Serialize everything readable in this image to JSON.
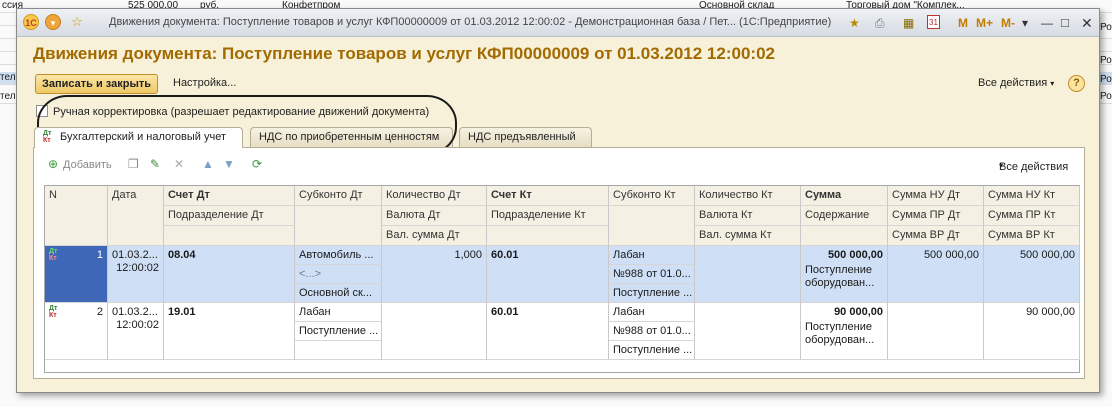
{
  "background": {
    "rows": [
      {
        "c1": "ссия",
        "c2": "525 000,00",
        "c3": "руб.",
        "c4": "Конфетпром",
        "c5": "Основной склад",
        "c6": "Торговый дом \"Комплек..."
      },
      {
        "c1": "",
        "c2": "",
        "c3": "",
        "c4": "",
        "c5": "",
        "c6": ""
      },
      {
        "c1": "",
        "c2": "",
        "c3": "",
        "c4": "",
        "c5": "",
        "c6": ""
      },
      {
        "c1": "",
        "c2": "",
        "c3": "",
        "c4": "",
        "c5": "",
        "c6": ""
      },
      {
        "c1": "",
        "c2": "",
        "c3": "",
        "c4": "",
        "c5": "",
        "c6": ""
      },
      {
        "c1": "",
        "c2": "",
        "c3": "",
        "c4": "",
        "c5": "",
        "c6": ""
      }
    ],
    "left_labels": [
      "тель",
      "тель"
    ],
    "right_labels": [
      "Рос",
      "Рос",
      "Рос",
      "Рос"
    ]
  },
  "window": {
    "title": "Движения документа: Поступление товаров и услуг КФП00000009 от 01.03.2012 12:00:02 - Демонстрационная база / Пет... (1С:Предприятие)",
    "logo": "1C",
    "right_controls": [
      "M",
      "M+",
      "M-"
    ],
    "calendar_day": "31"
  },
  "heading": "Движения документа: Поступление товаров и услуг КФП00000009 от 01.03.2012 12:00:02",
  "command_bar": {
    "save_close": "Записать и закрыть",
    "settings": "Настройка...",
    "all_actions": "Все действия",
    "help": "?"
  },
  "manual": {
    "label": "Ручная корректировка (разрешает редактирование движений документа)",
    "checked": false
  },
  "tabs": [
    {
      "label": "Бухгалтерский и налоговый учет",
      "active": true
    },
    {
      "label": "НДС по приобретенным ценностям",
      "active": false
    },
    {
      "label": "НДС предъявленный",
      "active": false
    }
  ],
  "tab_icon": {
    "top": "Дт",
    "bottom": "Кт"
  },
  "table_toolbar": {
    "add": "Добавить",
    "all_actions": "Все действия"
  },
  "table": {
    "headers": {
      "n": "N",
      "date": "Дата",
      "acc_dt": "Счет Дт",
      "dept_dt": "Подразделение Дт",
      "sub_dt": "Субконто Дт",
      "qty_dt": "Количество Дт",
      "cur_dt": "Валюта Дт",
      "cur_sum_dt": "Вал. сумма Дт",
      "acc_kt": "Счет Кт",
      "dept_kt": "Подразделение Кт",
      "sub_kt": "Субконто Кт",
      "qty_kt": "Количество Кт",
      "cur_kt": "Валюта Кт",
      "cur_sum_kt": "Вал. сумма Кт",
      "sum": "Сумма",
      "content": "Содержание",
      "nu_dt": "Сумма НУ Дт",
      "pr_dt": "Сумма ПР Дт",
      "vr_dt": "Сумма ВР Дт",
      "nu_kt": "Сумма НУ Кт",
      "pr_kt": "Сумма ПР Кт",
      "vr_kt": "Сумма ВР Кт"
    },
    "rows": [
      {
        "n": "1",
        "date1": "01.03.2...",
        "date2": "12:00:02",
        "acc_dt": "08.04",
        "sub_dt1": "Автомобиль ...",
        "sub_dt2": "<...>",
        "sub_dt3": "Основной ск...",
        "qty_dt": "1,000",
        "acc_kt": "60.01",
        "sub_kt1": "Лабан",
        "sub_kt2": "№988 от 01.0...",
        "sub_kt3": "Поступление ...",
        "sum": "500 000,00",
        "content1": "Поступление",
        "content2": "оборудован...",
        "nu_dt": "500 000,00",
        "nu_kt": "500 000,00"
      },
      {
        "n": "2",
        "date1": "01.03.2...",
        "date2": "12:00:02",
        "acc_dt": "19.01",
        "sub_dt1": "Лабан",
        "sub_dt2": "Поступление ...",
        "acc_kt": "60.01",
        "sub_kt1": "Лабан",
        "sub_kt2": "№988 от 01.0...",
        "sub_kt3": "Поступление ...",
        "sum": "90 000,00",
        "content1": "Поступление",
        "content2": "оборудован...",
        "nu_kt": "90 000,00"
      }
    ]
  },
  "colors": {
    "heading": "#a26a00",
    "window_bg": "#f7f1d9",
    "selected_row": "#cfe0f6",
    "accent_button": "#efc964"
  }
}
